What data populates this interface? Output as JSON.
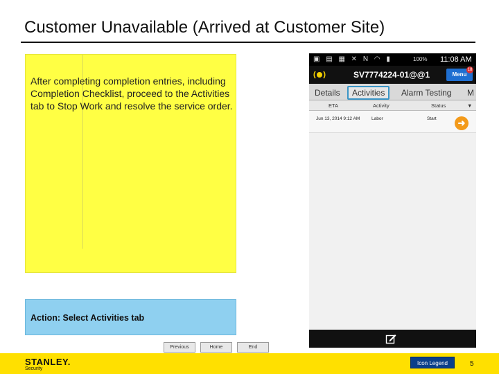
{
  "slide": {
    "title": "Customer Unavailable (Arrived at Customer Site)",
    "note": "After completing completion entries, including Completion Checklist, proceed to the Activities tab to Stop Work and resolve the service order.",
    "action": "Action: Select Activities tab",
    "nav": {
      "previous": "Previous",
      "home": "Home",
      "end": "End"
    },
    "footer": {
      "brand": "STANLEY.",
      "brand_sub": "Security",
      "legend": "Icon Legend",
      "page": "5"
    }
  },
  "phone": {
    "status": {
      "battery": "100%",
      "time": "11:08 AM",
      "icons": [
        "notification-icon",
        "app-icon",
        "photo-icon",
        "mute-icon",
        "nfc-icon",
        "wifi-icon",
        "signal-icon",
        "battery-icon"
      ]
    },
    "order_title": "SV7774224-01@@1",
    "menu_label": "Menu",
    "menu_badge": "18",
    "tabs": [
      {
        "label": "Details",
        "active": false
      },
      {
        "label": "Activities",
        "active": true
      },
      {
        "label": "Alarm Testing",
        "active": false
      },
      {
        "label": "M",
        "active": false
      }
    ],
    "columns": [
      "ETA",
      "Activity",
      "Status"
    ],
    "rows": [
      {
        "eta": "Jun 13, 2014 9:12 AM",
        "activity": "Labor",
        "status": "Start"
      }
    ],
    "colors": {
      "accent": "#3a95c6",
      "go": "#f39a1a",
      "menu": "#1f6fd1",
      "note": "#ffff44",
      "action": "#8fd0f0",
      "footer": "#ffe000"
    }
  }
}
